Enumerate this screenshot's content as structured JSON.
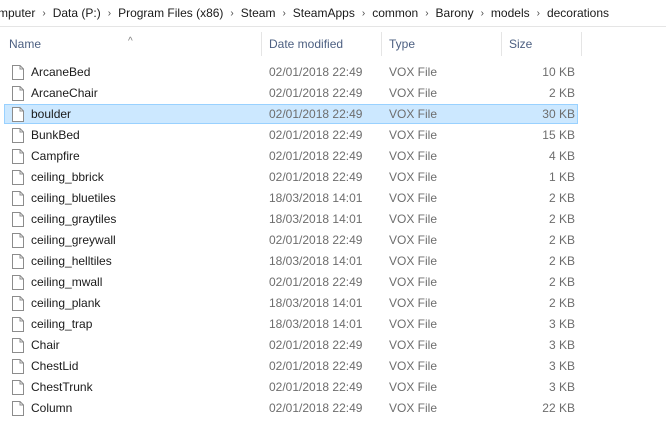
{
  "breadcrumb": [
    "mputer",
    "Data (P:)",
    "Program Files (x86)",
    "Steam",
    "SteamApps",
    "common",
    "Barony",
    "models",
    "decorations"
  ],
  "columns": {
    "name": "Name",
    "date": "Date modified",
    "type": "Type",
    "size": "Size"
  },
  "sort_indicator": "^",
  "selected_index": 2,
  "files": [
    {
      "name": "ArcaneBed",
      "date": "02/01/2018 22:49",
      "type": "VOX File",
      "size": "10 KB"
    },
    {
      "name": "ArcaneChair",
      "date": "02/01/2018 22:49",
      "type": "VOX File",
      "size": "2 KB"
    },
    {
      "name": "boulder",
      "date": "02/01/2018 22:49",
      "type": "VOX File",
      "size": "30 KB"
    },
    {
      "name": "BunkBed",
      "date": "02/01/2018 22:49",
      "type": "VOX File",
      "size": "15 KB"
    },
    {
      "name": "Campfire",
      "date": "02/01/2018 22:49",
      "type": "VOX File",
      "size": "4 KB"
    },
    {
      "name": "ceiling_bbrick",
      "date": "02/01/2018 22:49",
      "type": "VOX File",
      "size": "1 KB"
    },
    {
      "name": "ceiling_bluetiles",
      "date": "18/03/2018 14:01",
      "type": "VOX File",
      "size": "2 KB"
    },
    {
      "name": "ceiling_graytiles",
      "date": "18/03/2018 14:01",
      "type": "VOX File",
      "size": "2 KB"
    },
    {
      "name": "ceiling_greywall",
      "date": "02/01/2018 22:49",
      "type": "VOX File",
      "size": "2 KB"
    },
    {
      "name": "ceiling_helltiles",
      "date": "18/03/2018 14:01",
      "type": "VOX File",
      "size": "2 KB"
    },
    {
      "name": "ceiling_mwall",
      "date": "02/01/2018 22:49",
      "type": "VOX File",
      "size": "2 KB"
    },
    {
      "name": "ceiling_plank",
      "date": "18/03/2018 14:01",
      "type": "VOX File",
      "size": "2 KB"
    },
    {
      "name": "ceiling_trap",
      "date": "18/03/2018 14:01",
      "type": "VOX File",
      "size": "3 KB"
    },
    {
      "name": "Chair",
      "date": "02/01/2018 22:49",
      "type": "VOX File",
      "size": "3 KB"
    },
    {
      "name": "ChestLid",
      "date": "02/01/2018 22:49",
      "type": "VOX File",
      "size": "3 KB"
    },
    {
      "name": "ChestTrunk",
      "date": "02/01/2018 22:49",
      "type": "VOX File",
      "size": "3 KB"
    },
    {
      "name": "Column",
      "date": "02/01/2018 22:49",
      "type": "VOX File",
      "size": "22 KB"
    }
  ]
}
